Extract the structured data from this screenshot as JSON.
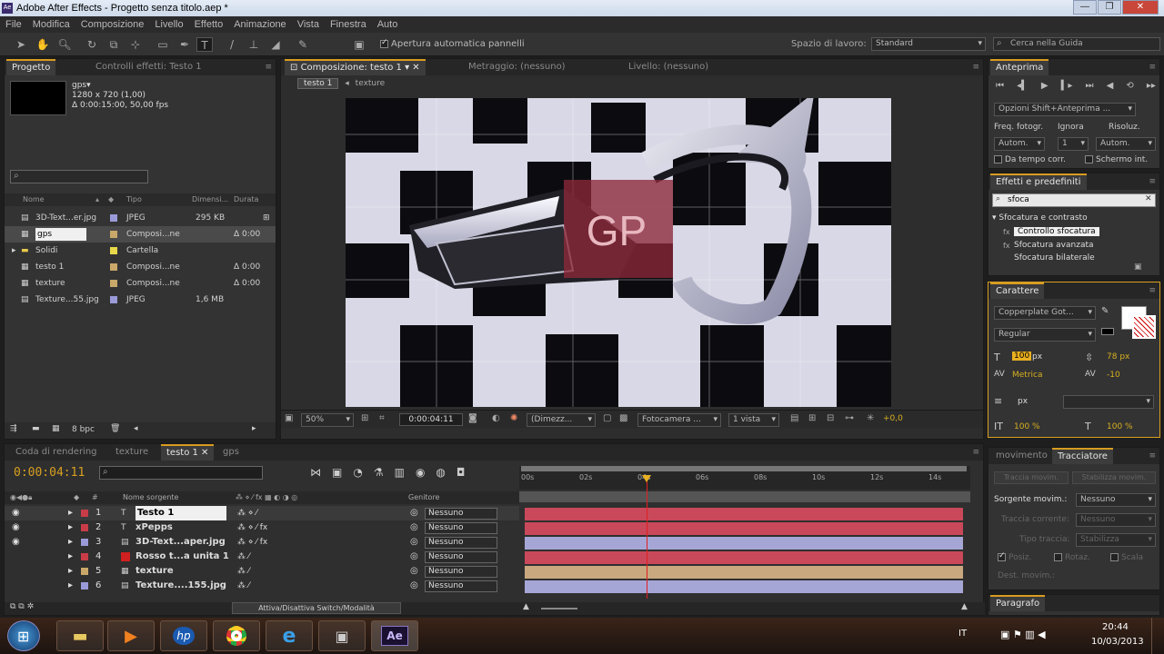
{
  "window": {
    "title": "Adobe After Effects - Progetto senza titolo.aep *",
    "app_badge": "Ae"
  },
  "menu": [
    "File",
    "Modifica",
    "Composizione",
    "Livello",
    "Effetto",
    "Animazione",
    "Vista",
    "Finestra",
    "Auto"
  ],
  "toolbar": {
    "auto_open_label": "Apertura automatica pannelli",
    "workspace_label": "Spazio di lavoro:",
    "workspace_value": "Standard",
    "search_placeholder": "Cerca nella Guida"
  },
  "project_panel": {
    "tab_project": "Progetto",
    "tab_effects": "Controlli effetti: Testo 1",
    "item_name": "gps▾",
    "item_size": "1280 x 720 (1,00)",
    "item_duration": "Δ 0:00:15:00, 50,00 fps",
    "columns": [
      "Nome",
      "Tipo",
      "Dimensi...",
      "Durata"
    ],
    "items": [
      {
        "name": "3D-Text...er.jpg",
        "type": "JPEG",
        "size": "295 KB",
        "duration": "",
        "color": "#9a9ad8",
        "icon": "image-icon"
      },
      {
        "name": "gps",
        "type": "Composi...ne",
        "size": "",
        "duration": "Δ 0:00",
        "color": "#c9a86a",
        "icon": "composition-icon"
      },
      {
        "name": "Solidi",
        "type": "Cartella",
        "size": "",
        "duration": "",
        "color": "#e8d84a",
        "icon": "folder-icon"
      },
      {
        "name": "testo 1",
        "type": "Composi...ne",
        "size": "",
        "duration": "Δ 0:00",
        "color": "#c9a86a",
        "icon": "composition-icon"
      },
      {
        "name": "texture",
        "type": "Composi...ne",
        "size": "",
        "duration": "Δ 0:00",
        "color": "#c9a86a",
        "icon": "composition-icon"
      },
      {
        "name": "Texture...55.jpg",
        "type": "JPEG",
        "size": "1,6 MB",
        "duration": "",
        "color": "#9a9ad8",
        "icon": "image-icon"
      }
    ],
    "bpc": "8 bpc"
  },
  "comp_panel": {
    "tab_comp": "Composizione: testo 1",
    "tab_footage": "Metraggio: (nessuno)",
    "tab_layer": "Livello: (nessuno)",
    "breadcrumb": [
      "testo 1",
      "texture"
    ],
    "overlay_text": "GP",
    "zoom": "50%",
    "timecode": "0:00:04:11",
    "resolution": "(Dimezz...",
    "camera": "Fotocamera ...",
    "views": "1 vista",
    "exposure": "+0,0"
  },
  "preview_panel": {
    "tab": "Anteprima",
    "options": "Opzioni Shift+Anteprima ...",
    "frame_rate_label": "Freq. fotogr.",
    "skip_label": "Ignora",
    "resolution_label": "Risoluz.",
    "frame_rate_value": "Autom.",
    "skip_value": "1",
    "resolution_value": "Autom.",
    "from_current": "Da tempo corr.",
    "full_screen": "Schermo int."
  },
  "effects_panel": {
    "tab": "Effetti e predefiniti",
    "search_value": "sfoca",
    "category": "Sfocatura e contrasto",
    "items": [
      "Controllo sfocatura",
      "Sfocatura avanzata",
      "Sfocatura bilaterale"
    ]
  },
  "character_panel": {
    "tab": "Carattere",
    "font": "Copperplate Got...",
    "style": "Regular",
    "size": "px",
    "size_value": "px",
    "leading": "78 px",
    "kerning": "Metrica",
    "tracking": "-10",
    "stroke": "px",
    "vscale": "100 %",
    "hscale": "100 %"
  },
  "tracker_panel": {
    "tab_motion": "movimento",
    "tab": "Tracciatore",
    "track_motion": "Traccia movim.",
    "stabilize": "Stabilizza movim.",
    "source_label": "Sorgente movim.:",
    "source_value": "Nessuno",
    "current_track": "Traccia corrente:",
    "current_value": "Nessuno",
    "track_type": "Tipo traccia:",
    "track_type_value": "Stabilizza",
    "position": "Posiz.",
    "rotation": "Rotaz.",
    "scale": "Scala",
    "target": "Dest. movim.:"
  },
  "paragraph_panel": {
    "tab": "Paragrafo"
  },
  "timeline": {
    "tabs": [
      "Coda di rendering",
      "texture",
      "testo 1",
      "gps"
    ],
    "timecode": "0:00:04:11",
    "col_name": "Nome sorgente",
    "col_parent": "Genitore",
    "ruler": [
      "00s",
      "02s",
      "04s",
      "06s",
      "08s",
      "10s",
      "12s",
      "14s"
    ],
    "toggle_label": "Attiva/Disattiva Switch/Modalità",
    "layers": [
      {
        "num": "1",
        "name": "Testo 1",
        "label": "#c83c48",
        "type": "T",
        "parent": "Nessuno",
        "bar": "#c9485a",
        "fx": false
      },
      {
        "num": "2",
        "name": "xPepps",
        "label": "#c83c48",
        "type": "T",
        "parent": "Nessuno",
        "bar": "#c9485a",
        "fx": true
      },
      {
        "num": "3",
        "name": "3D-Text...aper.jpg",
        "label": "#9a9ad8",
        "type": "img",
        "parent": "Nessuno",
        "bar": "#a6a6d6",
        "fx": true
      },
      {
        "num": "4",
        "name": "Rosso t...a unita 1",
        "label": "#c83c48",
        "type": "solid",
        "parent": "Nessuno",
        "bar": "#c9485a",
        "fx": false
      },
      {
        "num": "5",
        "name": "texture",
        "label": "#c9a86a",
        "type": "comp",
        "parent": "Nessuno",
        "bar": "#c9a880",
        "fx": false
      },
      {
        "num": "6",
        "name": "Texture....155.jpg",
        "label": "#9a9ad8",
        "type": "img",
        "parent": "Nessuno",
        "bar": "#a6a6d6",
        "fx": false
      }
    ]
  },
  "taskbar": {
    "language": "IT",
    "time": "20:44",
    "date": "10/03/2013",
    "ae_label": "Ae"
  }
}
